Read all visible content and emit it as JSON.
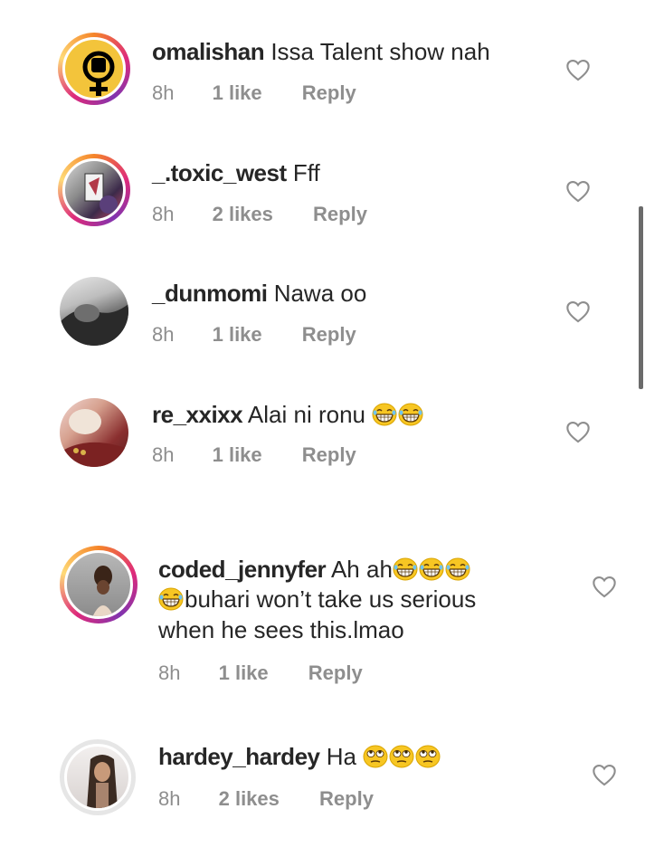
{
  "comments": [
    {
      "username": "omalishan",
      "text": "Issa Talent show nah",
      "time": "8h",
      "likes": "1 like",
      "reply": "Reply",
      "avatar_icon": "fist-female-symbol-icon"
    },
    {
      "username": "_.toxic_west",
      "text": "Fff",
      "time": "8h",
      "likes": "2 likes",
      "reply": "Reply",
      "avatar_icon": "photo-avatar"
    },
    {
      "username": "_dunmomi",
      "text": "Nawa oo",
      "time": "8h",
      "likes": "1 like",
      "reply": "Reply",
      "avatar_icon": "photo-avatar"
    },
    {
      "username": "re_xxixx",
      "text": "Alai ni ronu",
      "emojis": [
        "laughing-emoji",
        "laughing-emoji"
      ],
      "time": "8h",
      "likes": "1 like",
      "reply": "Reply",
      "avatar_icon": "photo-avatar"
    },
    {
      "username": "coded_jennyfer",
      "text_line1": "Ah ah",
      "text_line2": "buhari won’t take us serious",
      "text_line3": "when he sees this.lmao",
      "emojis": [
        "laughing-emoji",
        "laughing-emoji",
        "laughing-emoji",
        "laughing-emoji"
      ],
      "time": "8h",
      "likes": "1 like",
      "reply": "Reply",
      "avatar_icon": "photo-avatar"
    },
    {
      "username": "hardey_hardey",
      "text": "Ha",
      "emojis": [
        "eye-roll-emoji",
        "eye-roll-emoji",
        "eye-roll-emoji"
      ],
      "time": "8h",
      "likes": "2 likes",
      "reply": "Reply",
      "avatar_icon": "photo-avatar"
    }
  ],
  "colors": {
    "text": "#262626",
    "meta": "#8e8e8e",
    "heart": "#8e8e8e",
    "story_ring_start": "#f58529",
    "story_ring_end": "#dd2a7b"
  }
}
